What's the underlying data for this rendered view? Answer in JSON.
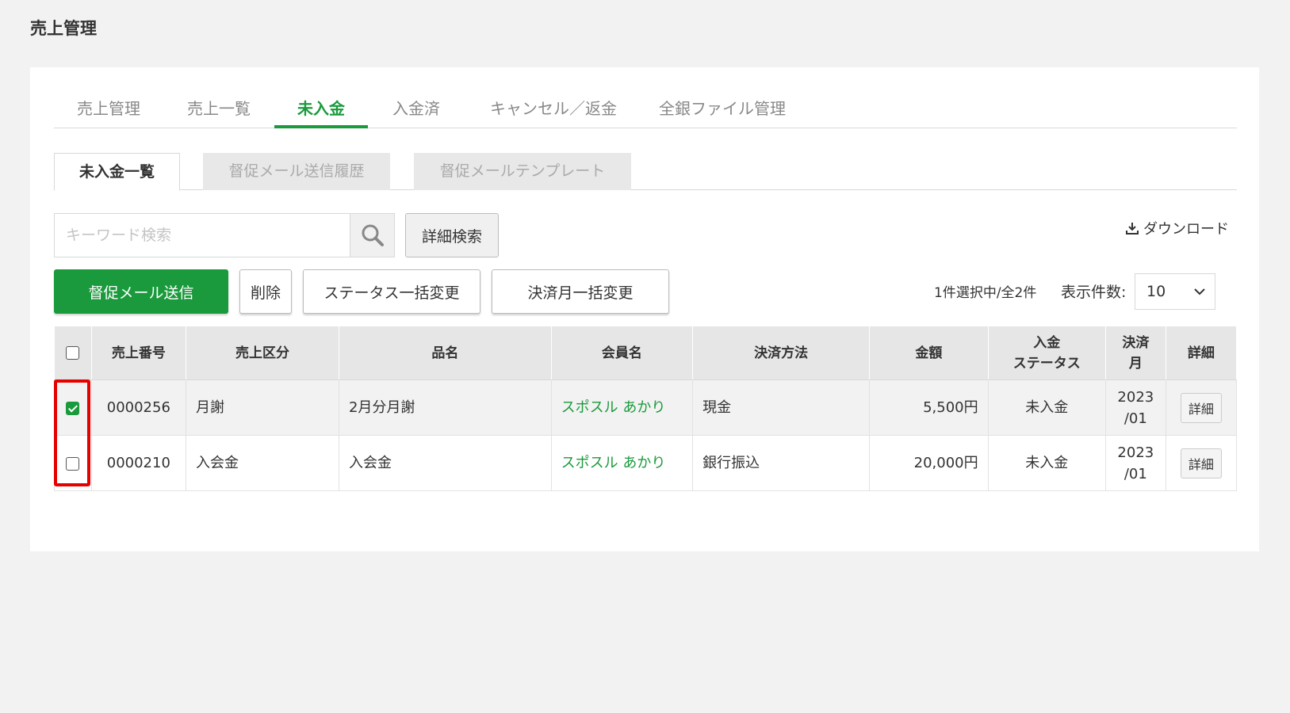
{
  "page_title": "売上管理",
  "main_tabs": [
    {
      "label": "売上管理"
    },
    {
      "label": "売上一覧"
    },
    {
      "label": "未入金"
    },
    {
      "label": "入金済"
    },
    {
      "label": "キャンセル／返金"
    },
    {
      "label": "全銀ファイル管理"
    }
  ],
  "main_tabs_active": "未入金",
  "sub_tabs": [
    {
      "label": "未入金一覧"
    },
    {
      "label": "督促メール送信履歴"
    },
    {
      "label": "督促メールテンプレート"
    }
  ],
  "sub_tabs_active": "未入金一覧",
  "search": {
    "placeholder": "キーワード検索",
    "value": "",
    "icon": "search-icon"
  },
  "advanced_search_label": "詳細検索",
  "download": {
    "label": "ダウンロード",
    "icon": "download-icon"
  },
  "actions": {
    "send_reminder": "督促メール送信",
    "delete": "削除",
    "bulk_status": "ステータス一括変更",
    "bulk_month": "決済月一括変更"
  },
  "selection_info": "1件選択中/全2件",
  "per_page": {
    "label": "表示件数:",
    "value": "10"
  },
  "table": {
    "headers": [
      "売上番号",
      "売上区分",
      "品名",
      "会員名",
      "決済方法",
      "金額",
      "入金\nステータス",
      "決済\n月",
      "詳細"
    ],
    "header_status_line1": "入金",
    "header_status_line2": "ステータス",
    "header_month_line1": "決済",
    "header_month_line2": "月",
    "rows": [
      {
        "checked": true,
        "sales_no": "0000256",
        "category": "月謝",
        "item": "2月分月謝",
        "member": "スポスル あかり",
        "payment_method": "現金",
        "amount": "5,500円",
        "status": "未入金",
        "month_line1": "2023",
        "month_line2": "/01",
        "detail": "詳細"
      },
      {
        "checked": false,
        "sales_no": "0000210",
        "category": "入会金",
        "item": "入会金",
        "member": "スポスル あかり",
        "payment_method": "銀行振込",
        "amount": "20,000円",
        "status": "未入金",
        "month_line1": "2023",
        "month_line2": "/01",
        "detail": "詳細"
      }
    ]
  },
  "colors": {
    "accent": "#1a9a3c",
    "highlight": "#e60000",
    "background": "#f2f2f2"
  }
}
